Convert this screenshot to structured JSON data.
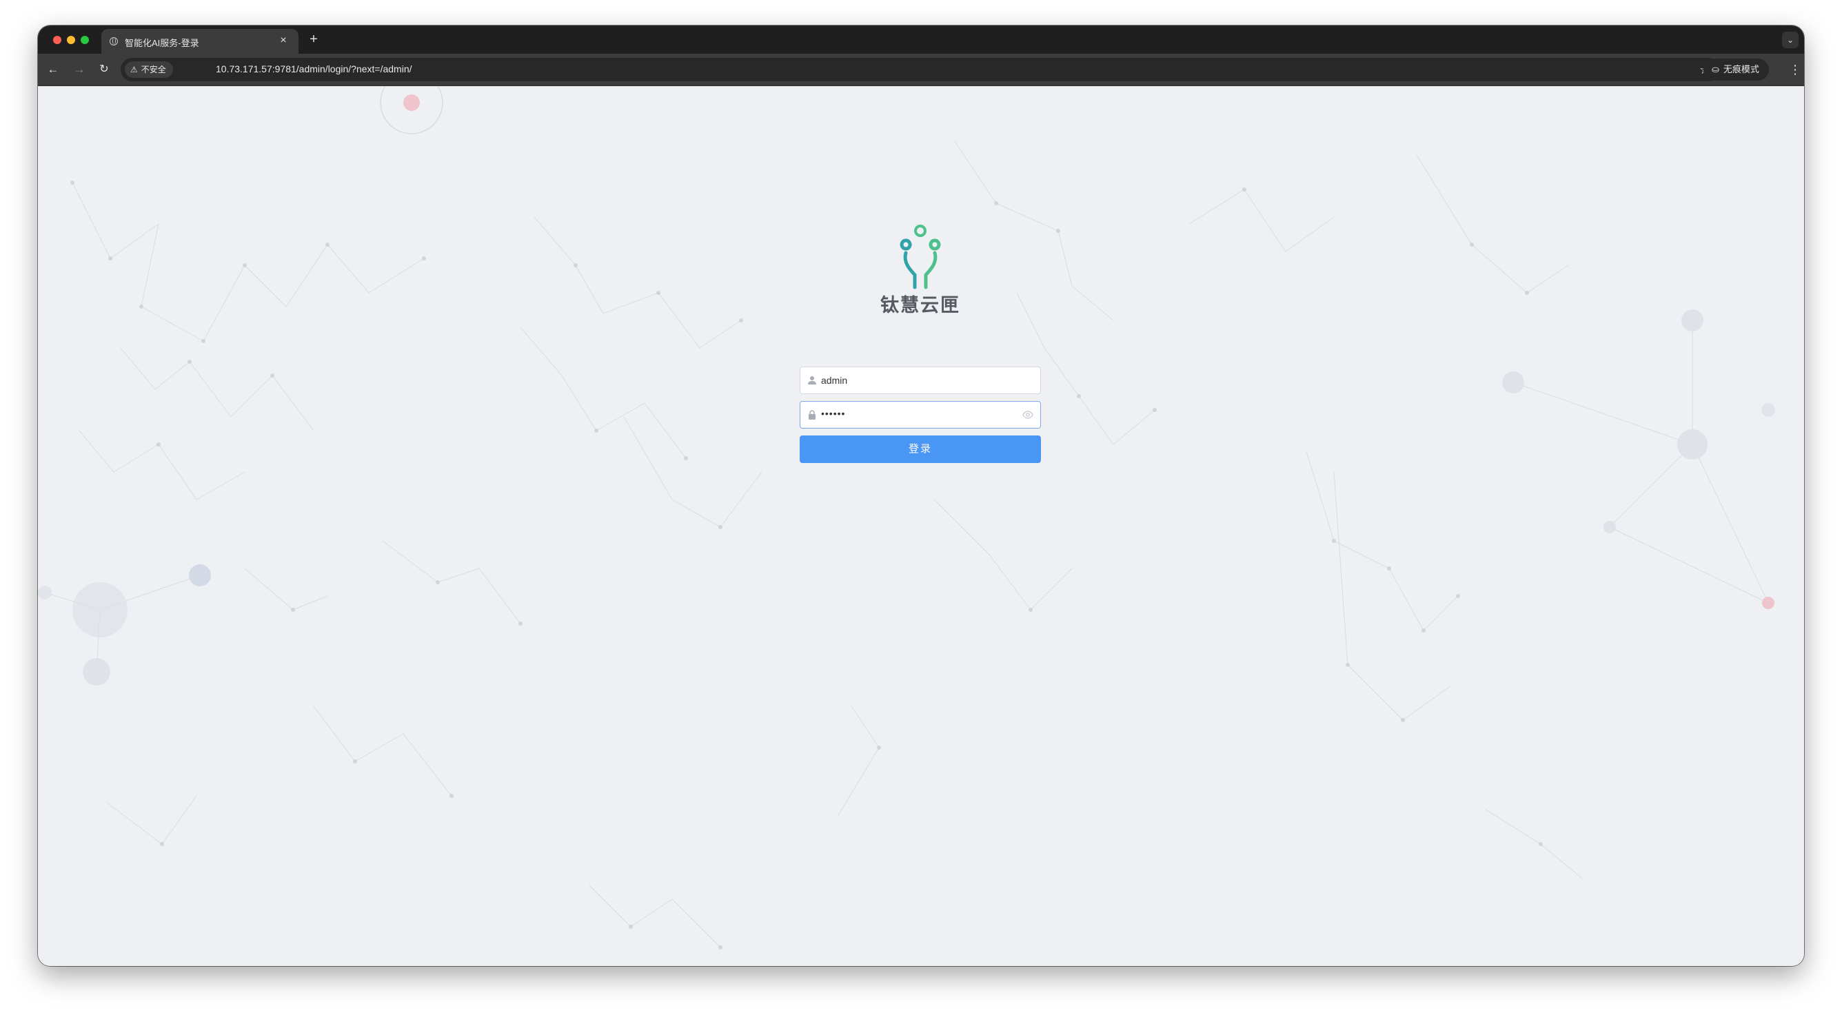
{
  "browser": {
    "tab_title": "智能化AI服务-登录",
    "tab_close": "×",
    "new_tab": "+",
    "tab_search": "⌄",
    "security_label": "不安全",
    "url": "10.73.171.57:9781/admin/login/?next=/admin/",
    "incognito_label": "无痕模式",
    "menu": "⋮",
    "back": "←",
    "forward": "→",
    "reload": "↻",
    "star": "☆",
    "warn_icon": "⚠",
    "incognito_icon": "⛀"
  },
  "login": {
    "brand_name": "钛慧云匣",
    "username_value": "admin",
    "password_value": "••••••",
    "submit_label": "登录"
  },
  "theme": {
    "page_bg": "#eff0f4",
    "primary": "#4a96f5",
    "logo_teal": "#2fa3a8",
    "logo_green": "#4ec08c",
    "logo_blue": "#2f7fb8"
  },
  "icons": [
    "user-icon",
    "lock-icon",
    "eye-icon",
    "logo-icon"
  ]
}
